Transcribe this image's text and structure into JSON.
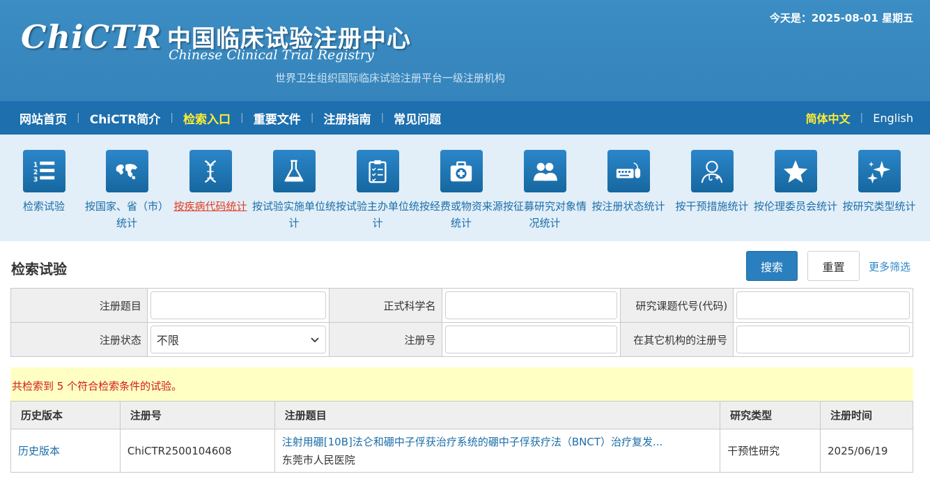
{
  "header": {
    "logo_text": "ChiCTR",
    "title_cn": "中国临床试验注册中心",
    "title_en": "Chinese Clinical Trial Registry",
    "subtitle": "世界卫生组织国际临床试验注册平台一级注册机构",
    "today": "今天是：2025-08-01 星期五"
  },
  "nav": {
    "items": [
      {
        "label": "网站首页"
      },
      {
        "label": "ChiCTR简介"
      },
      {
        "label": "检索入口"
      },
      {
        "label": "重要文件"
      },
      {
        "label": "注册指南"
      },
      {
        "label": "常见问题"
      }
    ],
    "separator": "|",
    "lang_cn": "简体中文",
    "lang_en": "English"
  },
  "iconbar": {
    "items": [
      {
        "label": "检索试验",
        "icon": "list-icon"
      },
      {
        "label": "按国家、省（市）统计",
        "icon": "world-map-icon"
      },
      {
        "label": "按疾病代码统计",
        "icon": "dna-icon"
      },
      {
        "label": "按试验实施单位统计",
        "icon": "flask-icon"
      },
      {
        "label": "按试验主办单位统计",
        "icon": "clipboard-icon"
      },
      {
        "label": "按经费或物资来源统计",
        "icon": "medical-kit-icon"
      },
      {
        "label": "按征募研究对象情况统计",
        "icon": "people-icon"
      },
      {
        "label": "按注册状态统计",
        "icon": "keyboard-mouse-icon"
      },
      {
        "label": "按干预措施统计",
        "icon": "doctor-icon"
      },
      {
        "label": "按伦理委员会统计",
        "icon": "star-icon"
      },
      {
        "label": "按研究类型统计",
        "icon": "sparkle-icon"
      }
    ]
  },
  "search": {
    "title": "检索试验",
    "search_button": "搜索",
    "reset_button": "重置",
    "more_filters": "更多筛选",
    "fields": {
      "reg_title_label": "注册题目",
      "reg_title_value": "",
      "sci_title_label": "正式科学名",
      "sci_title_value": "",
      "project_code_label": "研究课题代号(代码)",
      "project_code_value": "",
      "status_label": "注册状态",
      "status_value": "不限",
      "reg_no_label": "注册号",
      "reg_no_value": "",
      "other_reg_label": "在其它机构的注册号",
      "other_reg_value": ""
    }
  },
  "results": {
    "summary": "共检索到 5 个符合检索条件的试验。",
    "columns": [
      "历史版本",
      "注册号",
      "注册题目",
      "研究类型",
      "注册时间"
    ],
    "rows": [
      {
        "history": "历史版本",
        "reg_no": "ChiCTR2500104608",
        "title": "注射用硼[10B]法仑和硼中子俘获治疗系统的硼中子俘获疗法（BNCT）治疗复发...",
        "org": "东莞市人民医院",
        "type": "干预性研究",
        "date": "2025/06/19"
      }
    ]
  },
  "colors": {
    "header_bg": "#3a8cc1",
    "nav_bg": "#1d6fae",
    "nav_active": "#ffee33",
    "link": "#1b6ea8",
    "highlight": "#e43b1e",
    "result_bar": "#ffffc4"
  }
}
